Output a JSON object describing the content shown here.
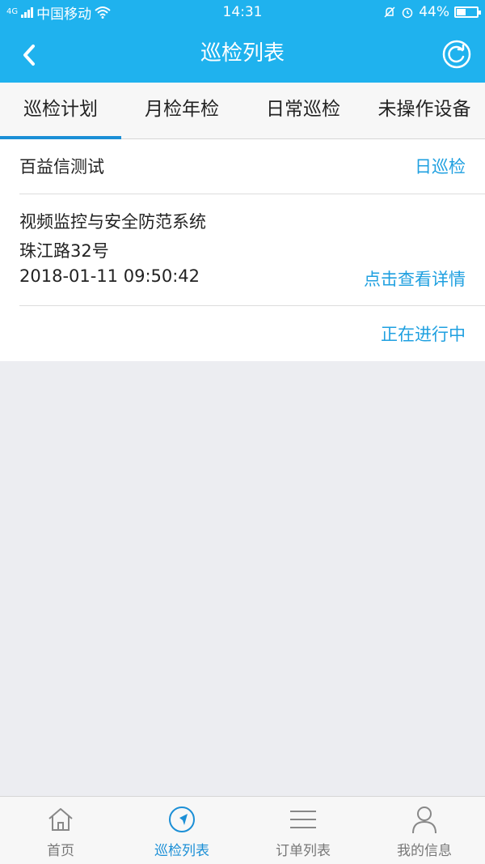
{
  "status_bar": {
    "network": "4G",
    "carrier": "中国移动",
    "time": "14:31",
    "battery_percent": "44%",
    "battery_level": 0.44
  },
  "header": {
    "title": "巡检列表"
  },
  "tabs": [
    {
      "label": "巡检计划",
      "active": true
    },
    {
      "label": "月检年检",
      "active": false
    },
    {
      "label": "日常巡检",
      "active": false
    },
    {
      "label": "未操作设备",
      "active": false
    }
  ],
  "inspection": {
    "name": "百益信测试",
    "type": "日巡检",
    "system": "视频监控与安全防范系统",
    "address": "珠江路32号",
    "datetime": "2018-01-11 09:50:42",
    "detail_link": "点击查看详情",
    "status": "正在进行中"
  },
  "bottom_nav": [
    {
      "label": "首页",
      "icon": "home-icon",
      "active": false
    },
    {
      "label": "巡检列表",
      "icon": "navigation-icon",
      "active": true
    },
    {
      "label": "订单列表",
      "icon": "list-icon",
      "active": false
    },
    {
      "label": "我的信息",
      "icon": "user-icon",
      "active": false
    }
  ],
  "colors": {
    "primary": "#1fb2ee",
    "active_tab": "#1b8fd6",
    "link": "#1fa0e0",
    "background": "#ecedf1"
  }
}
